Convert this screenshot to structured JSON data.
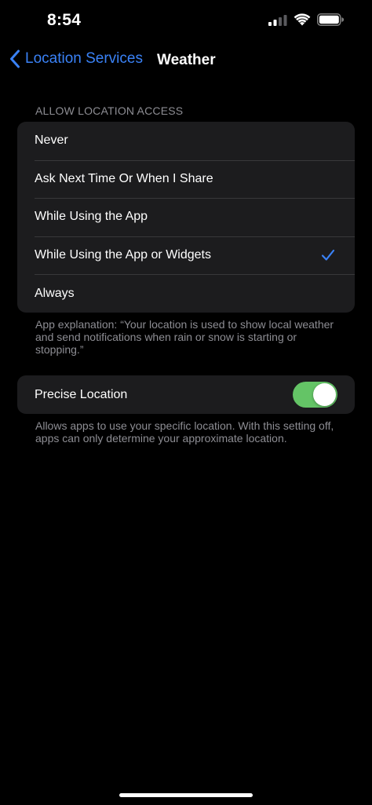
{
  "status_bar": {
    "time": "8:54"
  },
  "nav": {
    "back_label": "Location Services",
    "title": "Weather"
  },
  "allow_access": {
    "header": "ALLOW LOCATION ACCESS",
    "options": [
      {
        "label": "Never",
        "selected": false
      },
      {
        "label": "Ask Next Time Or When I Share",
        "selected": false
      },
      {
        "label": "While Using the App",
        "selected": false
      },
      {
        "label": "While Using the App or Widgets",
        "selected": true
      },
      {
        "label": "Always",
        "selected": false
      }
    ],
    "explanation": "App explanation: “Your location is used to show local weather and send notifications when rain or snow is starting or stopping.”"
  },
  "precise_location": {
    "label": "Precise Location",
    "enabled": true,
    "description": "Allows apps to use your specific location. With this setting off, apps can only determine your approximate location."
  },
  "colors": {
    "accent": "#3a82f7",
    "toggle_on": "#64c466",
    "group_background": "#1c1c1e",
    "secondary_text": "#8d8d93"
  },
  "icons": {
    "cellular": "cellular-signal-icon",
    "wifi": "wifi-icon",
    "battery": "battery-icon",
    "back": "chevron-left-icon",
    "check": "checkmark-icon"
  }
}
